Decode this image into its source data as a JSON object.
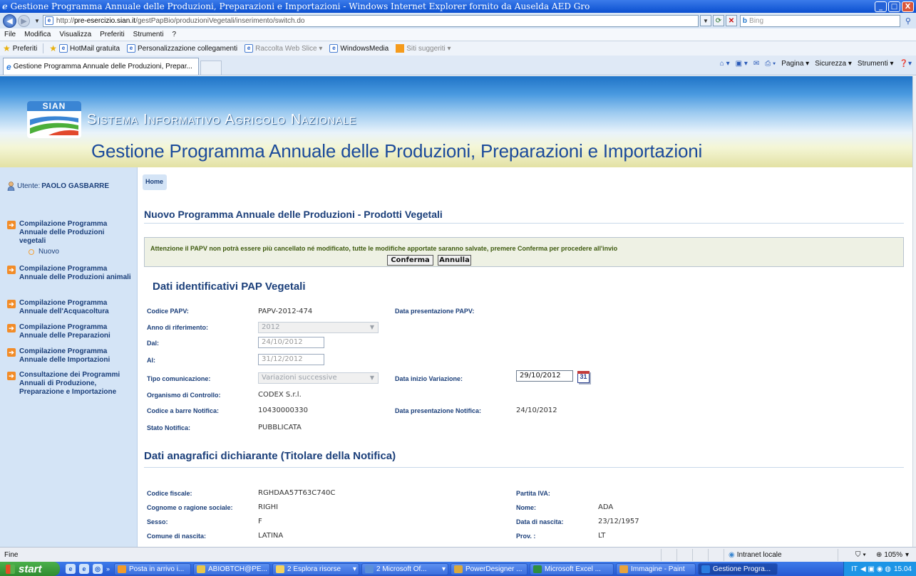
{
  "window": {
    "title": "Gestione Programma Annuale delle Produzioni, Preparazioni e Importazioni - Windows Internet Explorer fornito da Auselda AED Gro",
    "minimize": "_",
    "maximize": "□",
    "close": "X"
  },
  "address": {
    "url_prefix": "http://",
    "url_host": "pre-esercizio.sian.it",
    "url_path": "/gestPapBio/produzioniVegetali/inserimento/switch.do",
    "search_placeholder": "Bing"
  },
  "menu": [
    "File",
    "Modifica",
    "Visualizza",
    "Preferiti",
    "Strumenti",
    "?"
  ],
  "favorites": {
    "label": "Preferiti",
    "links": [
      {
        "label": "HotMail gratuita",
        "gray": false
      },
      {
        "label": "Personalizzazione collegamenti",
        "gray": false
      },
      {
        "label": "Raccolta Web Slice ▾",
        "gray": true
      },
      {
        "label": "WindowsMedia",
        "gray": false
      },
      {
        "label": "Siti suggeriti ▾",
        "gray": true
      }
    ]
  },
  "tab": {
    "label": "Gestione Programma Annuale delle Produzioni, Prepar..."
  },
  "commandbar": {
    "page": "Pagina ▾",
    "security": "Sicurezza ▾",
    "tools": "Strumenti ▾"
  },
  "banner": {
    "logo_text": "SIAN",
    "heading": "Sistema Informativo Agricolo Nazionale",
    "app_title": "Gestione Programma Annuale delle Produzioni, Preparazioni e Importazioni"
  },
  "user": {
    "prefix": "Utente:",
    "name": "PAOLO GASBARRE"
  },
  "sidebar": {
    "items": [
      {
        "label": "Compilazione Programma Annuale delle Produzioni vegetali"
      },
      {
        "label": "Compilazione Programma Annuale delle Produzioni animali"
      },
      {
        "label": "Compilazione Programma Annuale dell'Acquacoltura"
      },
      {
        "label": "Compilazione Programma Annuale delle Preparazioni"
      },
      {
        "label": "Compilazione Programma Annuale delle Importazioni"
      },
      {
        "label": "Consultazione dei Programmi Annuali di Produzione, Preparazione e Importazione"
      }
    ],
    "sub_item": "Nuovo"
  },
  "main": {
    "home": "Home",
    "title": "Nuovo Programma Annuale delle Produzioni - Prodotti Vegetali",
    "warning": "Attenzione il PAPV non potrà essere più cancellato né modificato, tutte le modifiche apportate saranno salvate, premere Conferma per procedere all'invio",
    "confirm_button": "Conferma",
    "cancel_button": "Annulla"
  },
  "section1": {
    "title": "Dati identificativi PAP Vegetali",
    "codice_label": "Codice PAPV:",
    "codice_value": "PAPV-2012-474",
    "data_pres_label": "Data presentazione PAPV:",
    "anno_label": "Anno di riferimento:",
    "anno_value": "2012",
    "dal_label": "Dal:",
    "dal_value": "24/10/2012",
    "al_label": "Al:",
    "al_value": "31/12/2012",
    "tipo_label": "Tipo comunicazione:",
    "tipo_value": "Variazioni successive",
    "data_inizio_label": "Data inizio Variazione:",
    "data_inizio_value": "29/10/2012",
    "calendar_day": "31",
    "organismo_label": "Organismo di Controllo:",
    "organismo_value": "CODEX S.r.l.",
    "barre_label": "Codice a barre Notifica:",
    "barre_value": "10430000330",
    "data_notifica_label": "Data presentazione Notifica:",
    "data_notifica_value": "24/10/2012",
    "stato_label": "Stato Notifica:",
    "stato_value": "PUBBLICATA"
  },
  "section2": {
    "title": "Dati anagrafici dichiarante (Titolare della Notifica)",
    "cf_label": "Codice fiscale:",
    "cf_value": "RGHDAA57T63C740C",
    "piva_label": "Partita IVA:",
    "cognome_label": "Cognome o ragione sociale:",
    "cognome_value": "RIGHI",
    "nome_label": "Nome:",
    "nome_value": "ADA",
    "sesso_label": "Sesso:",
    "sesso_value": "F",
    "nascita_label": "Data di nascita:",
    "nascita_value": "23/12/1957",
    "comune_label": "Comune di nascita:",
    "comune_value": "LATINA",
    "prov_label": "Prov. :",
    "prov_value": "LT"
  },
  "statusbar": {
    "status": "Fine",
    "zone": "Intranet locale",
    "zoom": "105%"
  },
  "taskbar": {
    "start": "start",
    "tasks": [
      {
        "label": "Posta in arrivo i...",
        "color": "#f29b2a"
      },
      {
        "label": "ABIOBTCH@PE...",
        "color": "#e8c64a"
      },
      {
        "label": "2 Esplora risorse",
        "color": "#f4d35e"
      },
      {
        "label": "2 Microsoft Of...",
        "color": "#5a8fd8"
      },
      {
        "label": "PowerDesigner ...",
        "color": "#d9a93c"
      },
      {
        "label": "Microsoft Excel ...",
        "color": "#2f8f3f"
      },
      {
        "label": "Immagine - Paint",
        "color": "#e8a33c"
      },
      {
        "label": "Gestione Progra...",
        "color": "#2b7de0"
      }
    ],
    "lang": "IT",
    "clock": "15.04"
  }
}
